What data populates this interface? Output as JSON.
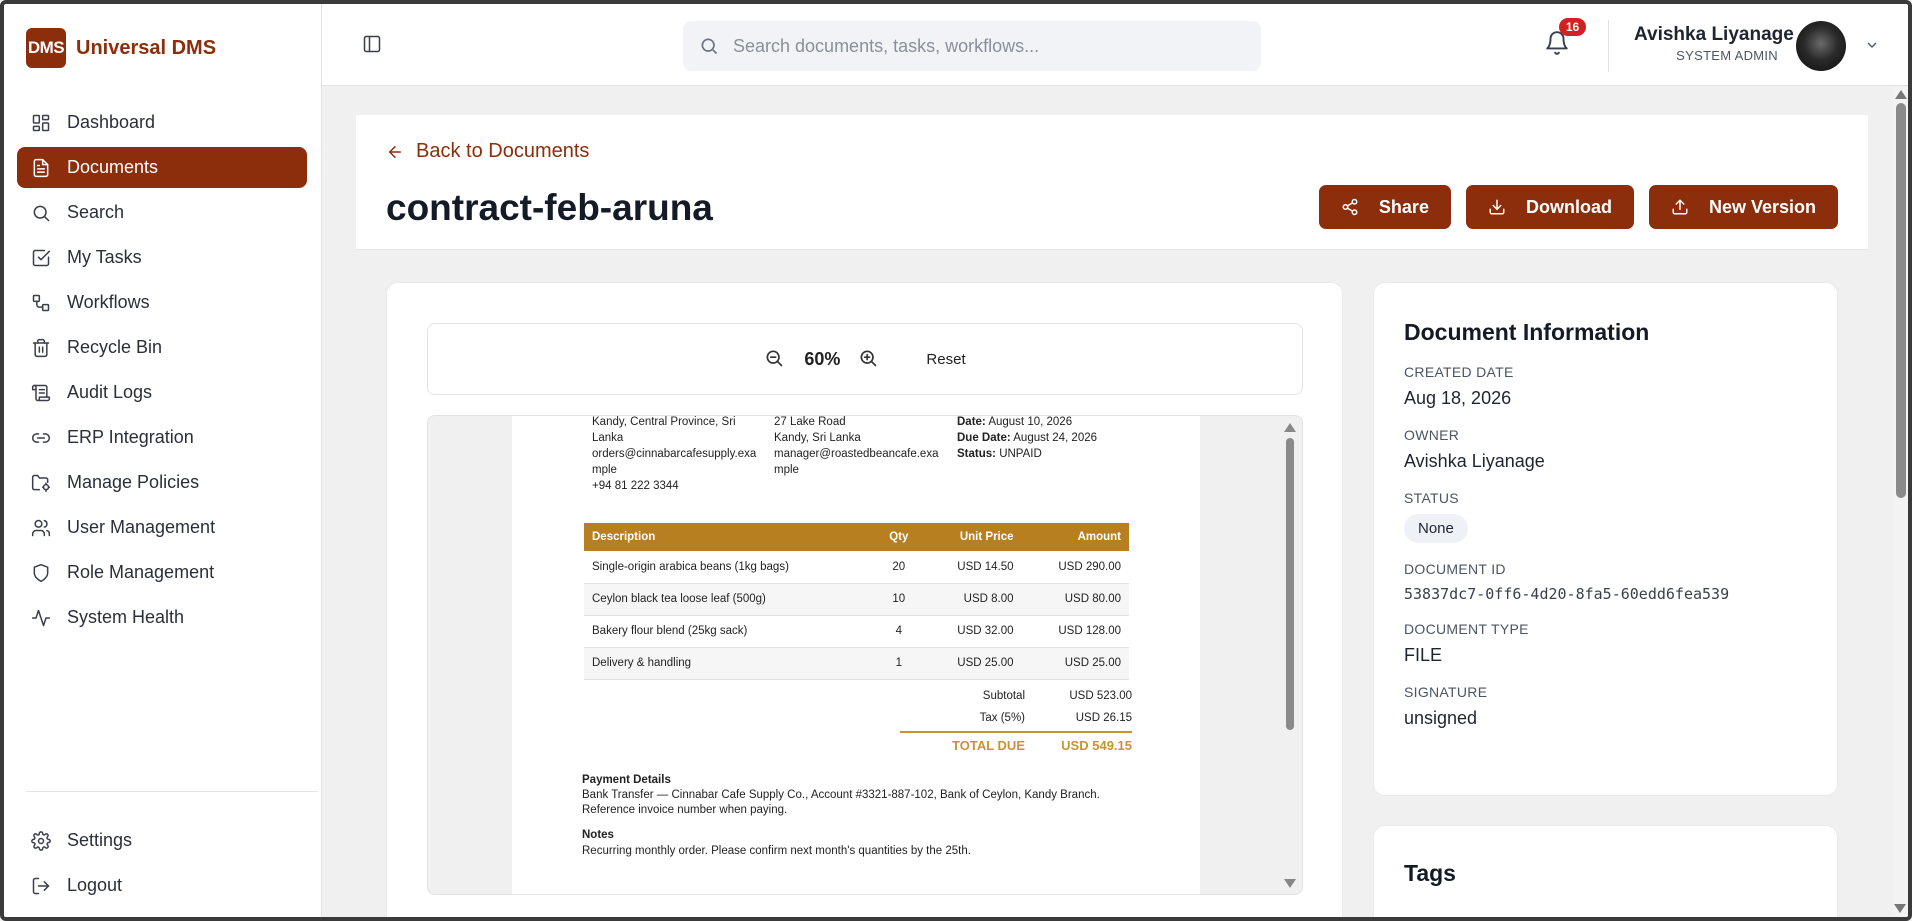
{
  "brand": {
    "logo": "DMS",
    "name": "Universal DMS"
  },
  "sidebar": {
    "items": [
      {
        "label": "Dashboard",
        "icon": "grid-icon"
      },
      {
        "label": "Documents",
        "icon": "document-icon",
        "active": true
      },
      {
        "label": "Search",
        "icon": "search-icon"
      },
      {
        "label": "My Tasks",
        "icon": "checkbox-icon"
      },
      {
        "label": "Workflows",
        "icon": "workflow-icon"
      },
      {
        "label": "Recycle Bin",
        "icon": "trash-icon"
      },
      {
        "label": "Audit Logs",
        "icon": "scroll-icon"
      },
      {
        "label": "ERP Integration",
        "icon": "link-icon"
      },
      {
        "label": "Manage Policies",
        "icon": "folder-settings-icon"
      },
      {
        "label": "User Management",
        "icon": "users-icon"
      },
      {
        "label": "Role Management",
        "icon": "shield-icon"
      },
      {
        "label": "System Health",
        "icon": "activity-icon"
      }
    ],
    "bottom": [
      {
        "label": "Settings",
        "icon": "gear-icon"
      },
      {
        "label": "Logout",
        "icon": "logout-icon"
      }
    ]
  },
  "topbar": {
    "search_placeholder": "Search documents, tasks, workflows...",
    "notifications_count": "16",
    "user_name": "Avishka Liyanage",
    "user_role": "SYSTEM ADMIN"
  },
  "header": {
    "back_label": "Back to Documents",
    "title": "contract-feb-aruna",
    "share_label": "Share",
    "download_label": "Download",
    "new_version_label": "New Version"
  },
  "viewer": {
    "zoom": "60%",
    "reset_label": "Reset"
  },
  "invoice": {
    "from_lines": [
      "Kandy, Central Province, Sri",
      "Lanka",
      "orders@cinnabarcafesupply.exa",
      "mple",
      "+94 81 222 3344"
    ],
    "to_lines": [
      "27 Lake Road",
      "Kandy, Sri Lanka",
      "manager@roastedbeancafe.exa",
      "mple"
    ],
    "meta": {
      "date_label": "Date:",
      "date_value": "August 10, 2026",
      "due_label": "Due Date:",
      "due_value": "August 24, 2026",
      "status_label": "Status:",
      "status_value": "UNPAID"
    },
    "table": {
      "headers": [
        "Description",
        "Qty",
        "Unit Price",
        "Amount"
      ],
      "rows": [
        [
          "Single-origin arabica beans (1kg bags)",
          "20",
          "USD 14.50",
          "USD 290.00"
        ],
        [
          "Ceylon black tea loose leaf (500g)",
          "10",
          "USD 8.00",
          "USD 80.00"
        ],
        [
          "Bakery flour blend (25kg sack)",
          "4",
          "USD 32.00",
          "USD 128.00"
        ],
        [
          "Delivery & handling",
          "1",
          "USD 25.00",
          "USD 25.00"
        ]
      ]
    },
    "subtotal_label": "Subtotal",
    "subtotal_value": "USD 523.00",
    "tax_label": "Tax (5%)",
    "tax_value": "USD 26.15",
    "total_label": "TOTAL DUE",
    "total_value": "USD 549.15",
    "payment_title": "Payment Details",
    "payment_line1": "Bank Transfer — Cinnabar Cafe Supply Co., Account #3321-887-102, Bank of Ceylon, Kandy Branch.",
    "payment_line2": "Reference invoice number when paying.",
    "notes_title": "Notes",
    "notes_line": "Recurring monthly order. Please confirm next month's quantities by the 25th."
  },
  "info": {
    "title": "Document Information",
    "created_label": "CREATED DATE",
    "created_value": "Aug 18, 2026",
    "owner_label": "OWNER",
    "owner_value": "Avishka Liyanage",
    "status_label": "STATUS",
    "status_value": "None",
    "id_label": "DOCUMENT ID",
    "id_value": "53837dc7-0ff6-4d20-8fa5-60edd6fea539",
    "type_label": "DOCUMENT TYPE",
    "type_value": "FILE",
    "signature_label": "SIGNATURE",
    "signature_value": "unsigned"
  },
  "tags": {
    "title": "Tags"
  },
  "colors": {
    "brand": "#8c2e0b",
    "invoice_header": "#b87f20",
    "total": "#c9942f",
    "badge": "#d42020"
  }
}
